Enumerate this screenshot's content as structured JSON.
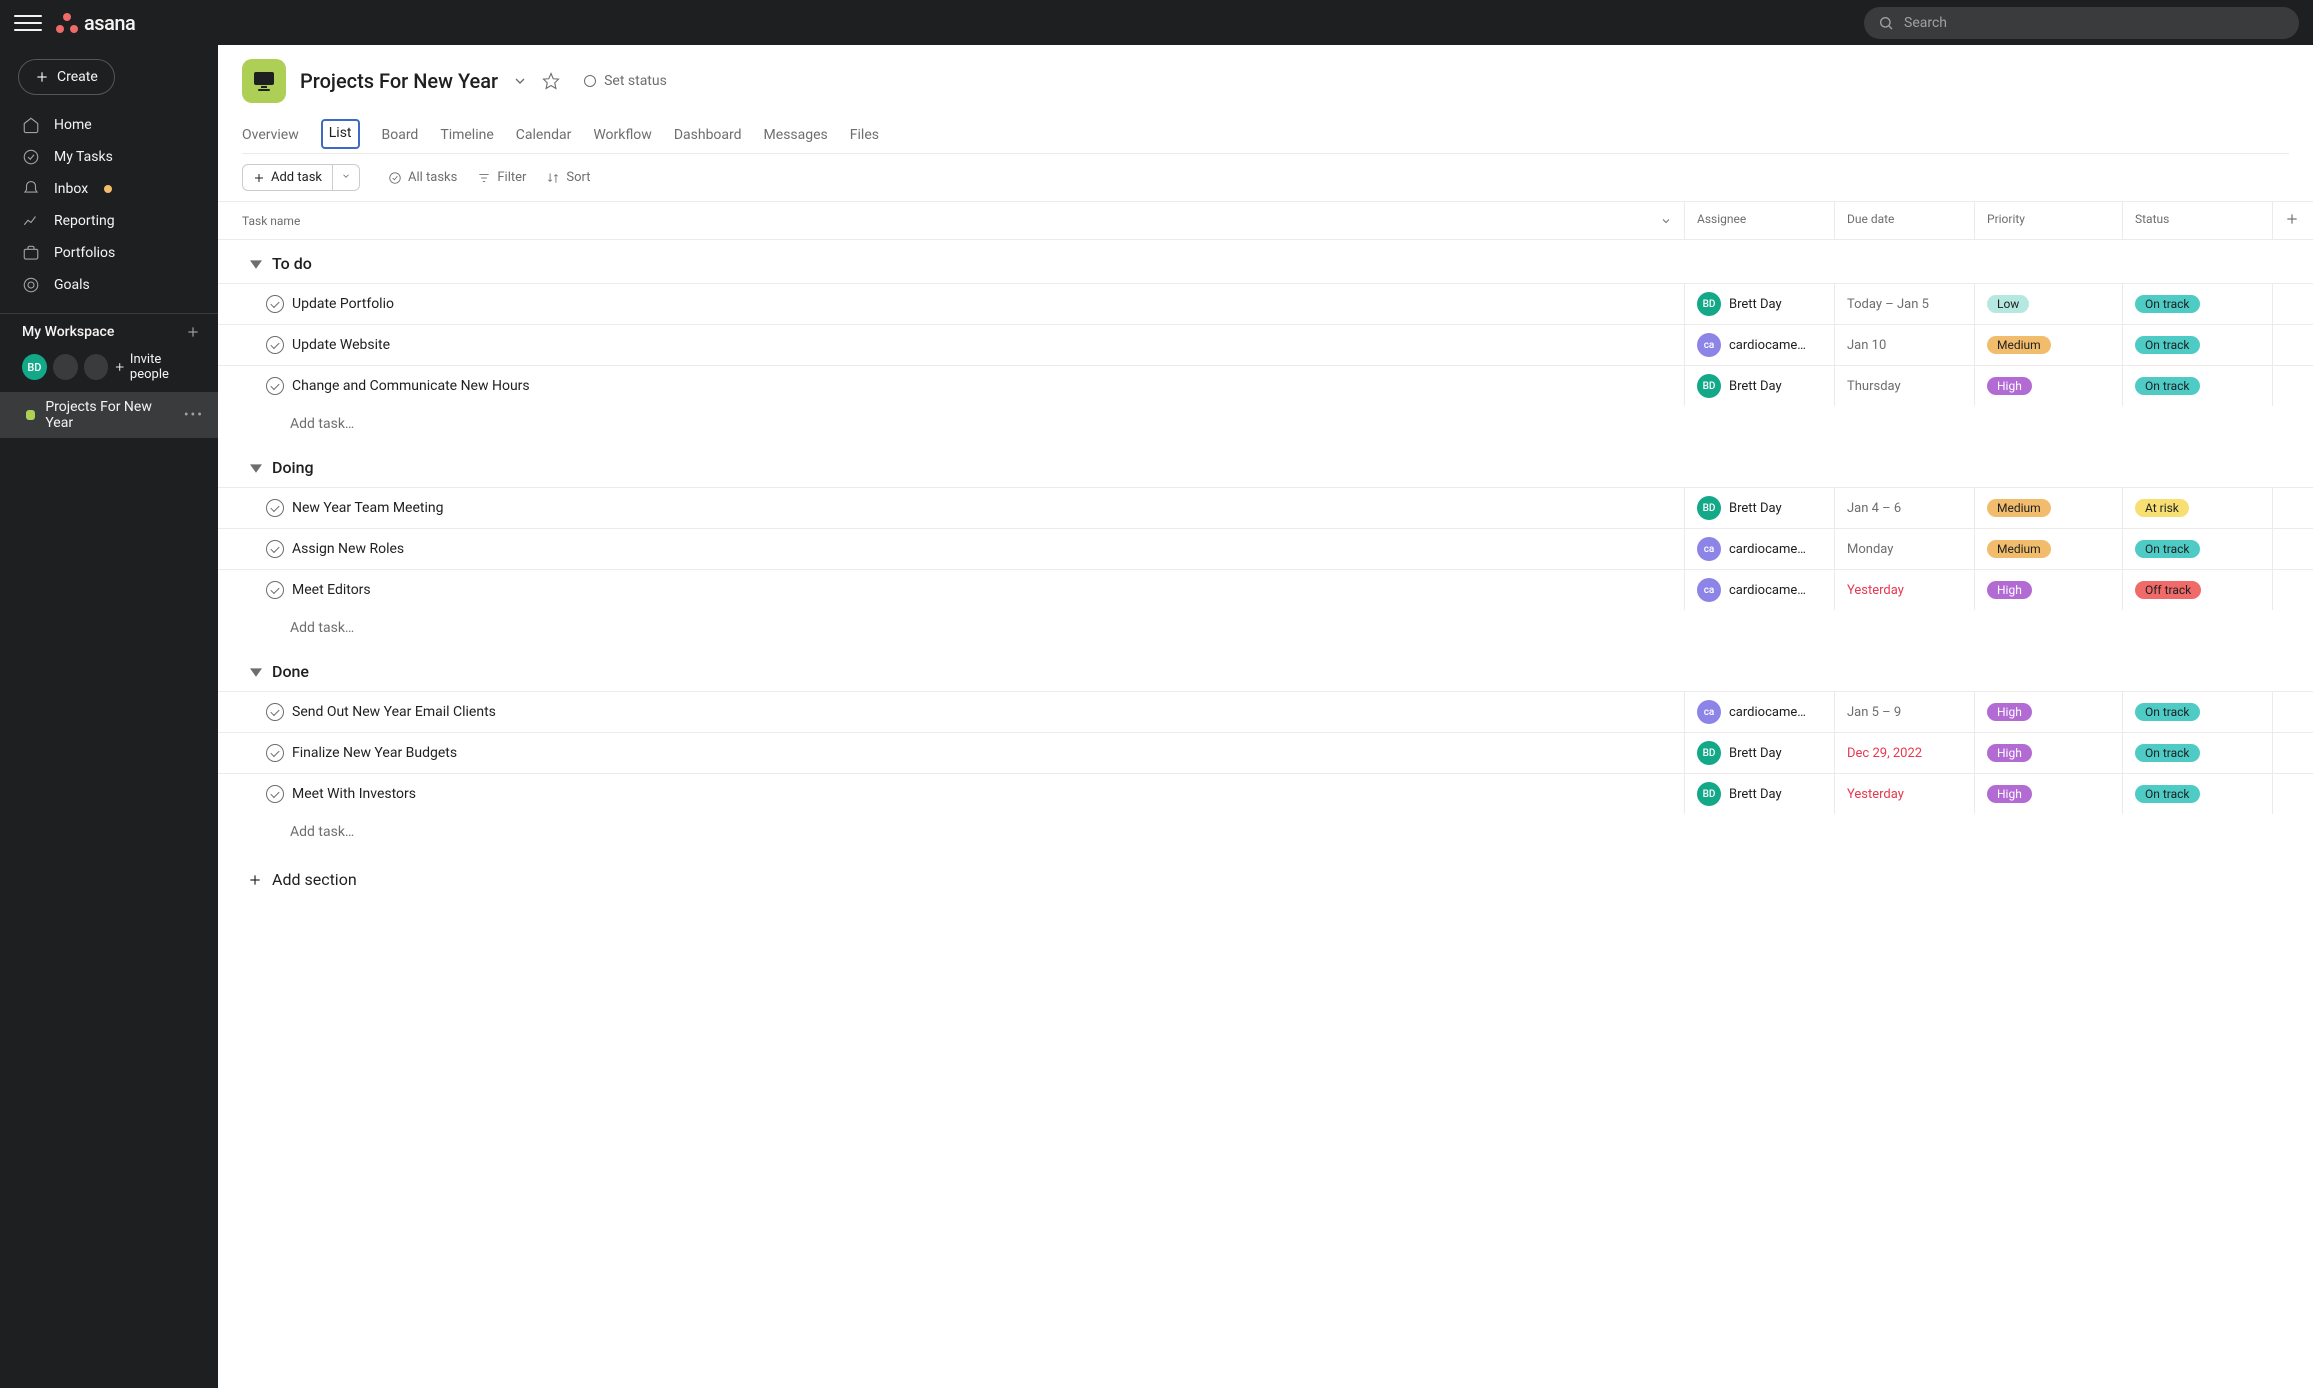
{
  "topbar": {
    "search_placeholder": "Search"
  },
  "sidebar": {
    "create_label": "Create",
    "nav": {
      "home": "Home",
      "mytasks": "My Tasks",
      "inbox": "Inbox",
      "reporting": "Reporting",
      "portfolios": "Portfolios",
      "goals": "Goals"
    },
    "workspace_label": "My Workspace",
    "invite_label": "Invite people",
    "avatars": {
      "a0_initials": "BD",
      "a0_color": "#12a888"
    },
    "project_label": "Projects For New Year"
  },
  "header": {
    "title": "Projects For New Year",
    "set_status": "Set status"
  },
  "tabs": {
    "overview": "Overview",
    "list": "List",
    "board": "Board",
    "timeline": "Timeline",
    "calendar": "Calendar",
    "workflow": "Workflow",
    "dashboard": "Dashboard",
    "messages": "Messages",
    "files": "Files"
  },
  "toolbar": {
    "add_task": "Add task",
    "all_tasks": "All tasks",
    "filter": "Filter",
    "sort": "Sort"
  },
  "columns": {
    "task_name": "Task name",
    "assignee": "Assignee",
    "due_date": "Due date",
    "priority": "Priority",
    "status": "Status"
  },
  "labels": {
    "add_task_placeholder": "Add task…",
    "add_section": "Add section"
  },
  "assignees": {
    "brett": {
      "name": "Brett Day",
      "initials": "BD",
      "color": "#12a888"
    },
    "cardio": {
      "name": "cardiocame…",
      "initials": "ca",
      "color": "#8d84e8"
    }
  },
  "priority_colors": {
    "Low": "#b5e8e0",
    "Medium": "#f1bd6c",
    "High": "#b36bd4"
  },
  "status_colors": {
    "On track": "#4ecbc4",
    "At risk": "#f8df72",
    "Off track": "#f06a6a"
  },
  "sections": [
    {
      "name": "To do",
      "tasks": [
        {
          "title": "Update Portfolio",
          "assignee": "brett",
          "due": "Today – Jan 5",
          "overdue": false,
          "priority": "Low",
          "status": "On track"
        },
        {
          "title": "Update Website",
          "assignee": "cardio",
          "due": "Jan 10",
          "overdue": false,
          "priority": "Medium",
          "status": "On track"
        },
        {
          "title": "Change and Communicate New Hours",
          "assignee": "brett",
          "due": "Thursday",
          "overdue": false,
          "priority": "High",
          "status": "On track"
        }
      ]
    },
    {
      "name": "Doing",
      "tasks": [
        {
          "title": "New Year Team Meeting",
          "assignee": "brett",
          "due": "Jan 4 – 6",
          "overdue": false,
          "priority": "Medium",
          "status": "At risk"
        },
        {
          "title": "Assign New Roles",
          "assignee": "cardio",
          "due": "Monday",
          "overdue": false,
          "priority": "Medium",
          "status": "On track"
        },
        {
          "title": "Meet Editors",
          "assignee": "cardio",
          "due": "Yesterday",
          "overdue": true,
          "priority": "High",
          "status": "Off track"
        }
      ]
    },
    {
      "name": "Done",
      "tasks": [
        {
          "title": "Send Out New Year Email Clients",
          "assignee": "cardio",
          "due": "Jan 5 – 9",
          "overdue": false,
          "priority": "High",
          "status": "On track"
        },
        {
          "title": "Finalize New Year Budgets",
          "assignee": "brett",
          "due": "Dec 29, 2022",
          "overdue": true,
          "priority": "High",
          "status": "On track"
        },
        {
          "title": "Meet With Investors",
          "assignee": "brett",
          "due": "Yesterday",
          "overdue": true,
          "priority": "High",
          "status": "On track"
        }
      ]
    }
  ]
}
